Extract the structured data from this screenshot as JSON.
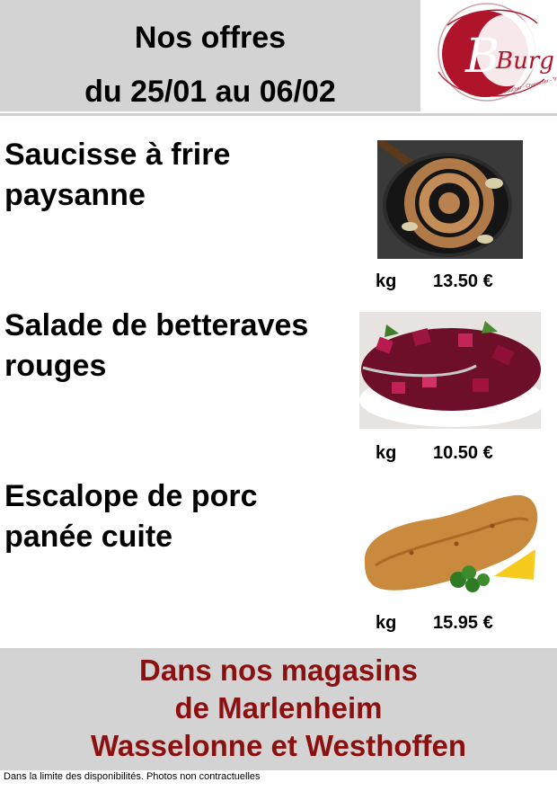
{
  "header": {
    "title": "Nos offres",
    "dates": "du 25/01 au 06/02"
  },
  "logo": {
    "letters": "Burg",
    "tagline": "Maître Boucher - Charcutier - Traiteur"
  },
  "products": [
    {
      "name_line1": "Saucisse à frire",
      "name_line2": "paysanne",
      "unit": "kg",
      "price": "13.50 €"
    },
    {
      "name_line1": "Salade de betteraves",
      "name_line2": "rouges",
      "unit": "kg",
      "price": "10.50 €"
    },
    {
      "name_line1": "Escalope de porc",
      "name_line2": "panée cuite",
      "unit": "kg",
      "price": "15.95 €"
    }
  ],
  "footer": {
    "line1": "Dans nos magasins",
    "line2": "de Marlenheim",
    "line3": "Wasselonne et Westhoffen"
  },
  "disclaimer": "Dans la limite des disponibilités. Photos non contractuelles",
  "colors": {
    "band_gray": "#d3d3d3",
    "footer_text": "#8b1111",
    "logo_red": "#b0142a"
  }
}
